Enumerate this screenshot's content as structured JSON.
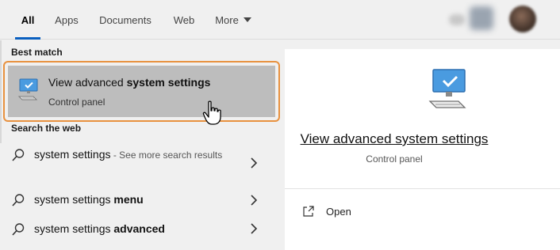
{
  "tabs": {
    "all": "All",
    "apps": "Apps",
    "documents": "Documents",
    "web": "Web",
    "more": "More"
  },
  "best_match": {
    "section_label": "Best match",
    "title_plain": "View advanced ",
    "title_bold": "system settings",
    "subtitle": "Control panel",
    "icon": "computer-settings-icon"
  },
  "search_web": {
    "section_label": "Search the web",
    "items": [
      {
        "plain": "system settings",
        "bold": "",
        "hint": " - See more search results"
      },
      {
        "plain": "system settings ",
        "bold": "menu",
        "hint": ""
      },
      {
        "plain": "system settings ",
        "bold": "advanced",
        "hint": ""
      }
    ]
  },
  "preview": {
    "title": "View advanced system settings",
    "subtitle": "Control panel",
    "actions": [
      {
        "label": "Open",
        "icon": "open-icon"
      }
    ]
  },
  "colors": {
    "accent": "#0a5fbf",
    "highlight_border": "#e8913f",
    "selected_bg": "#bdbdbd"
  }
}
